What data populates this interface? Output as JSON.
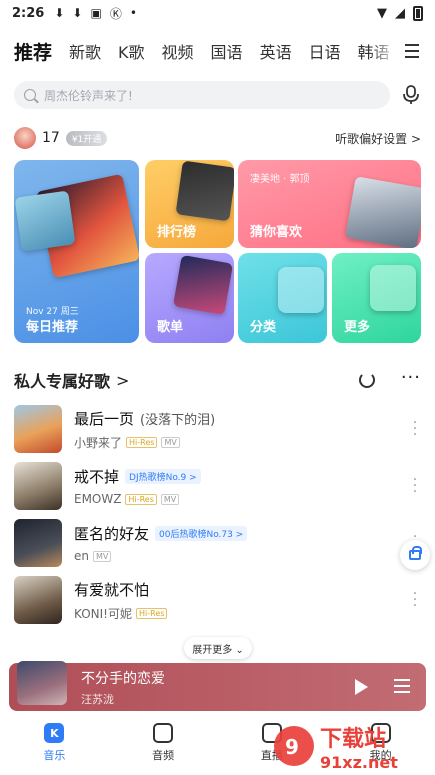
{
  "status_bar": {
    "time": "2:26"
  },
  "tabs": [
    "推荐",
    "新歌",
    "K歌",
    "视频",
    "国语",
    "英语",
    "日语",
    "韩语"
  ],
  "search": {
    "placeholder": "周杰伦铃声来了!"
  },
  "user": {
    "level": "17",
    "vip_badge": "¥1开通",
    "preference_link": "听歌偏好设置 >"
  },
  "grid": {
    "daily": {
      "label": "每日推荐",
      "date": "Nov 27 周三"
    },
    "charts": {
      "label": "排行榜"
    },
    "guess": {
      "label": "猜你喜欢",
      "subtitle": "凄美地 · 郭顶"
    },
    "playlists": {
      "label": "歌单"
    },
    "categories": {
      "label": "分类"
    },
    "more": {
      "label": "更多"
    }
  },
  "section": {
    "title": "私人专属好歌",
    "chevron": ">"
  },
  "songs": [
    {
      "title": "最后一页",
      "subtitle": "(没落下的泪)",
      "artist": "小野来了",
      "tags": [
        "Hi-Res",
        "MV"
      ],
      "chart": ""
    },
    {
      "title": "戒不掉",
      "subtitle": "",
      "artist": "EMOWZ",
      "tags": [
        "Hi-Res",
        "MV"
      ],
      "chart": "DJ热歌榜No.9 >"
    },
    {
      "title": "匿名的好友",
      "subtitle": "",
      "artist": "en",
      "tags": [
        "MV"
      ],
      "chart": "00后热歌榜No.73 >"
    },
    {
      "title": "有爱就不怕",
      "subtitle": "",
      "artist": "KONI!可妮",
      "tags": [
        "Hi-Res"
      ],
      "chart": ""
    }
  ],
  "expand_label": "展开更多 ⌄",
  "player": {
    "title": "不分手的恋爱",
    "artist": "汪苏泷"
  },
  "nav": [
    {
      "label": "音乐",
      "active": true
    },
    {
      "label": "音频",
      "active": false
    },
    {
      "label": "直播",
      "active": false
    },
    {
      "label": "我的",
      "active": false
    }
  ],
  "watermark": {
    "text": "下载站",
    "domain": "91xz.net"
  },
  "colors": {
    "accent": "#2f7cf6",
    "player_bg": "#b04e57"
  }
}
